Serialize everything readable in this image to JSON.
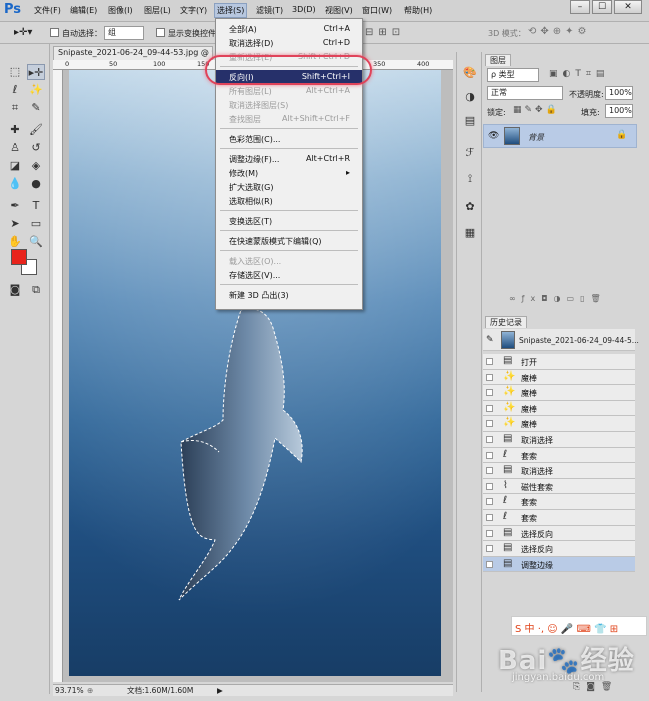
{
  "app": {
    "logo": "Ps"
  },
  "menubar": {
    "items": [
      "文件(F)",
      "编辑(E)",
      "图像(I)",
      "图层(L)",
      "文字(Y)",
      "选择(S)",
      "滤镜(T)",
      "3D(D)",
      "视图(V)",
      "窗口(W)",
      "帮助(H)"
    ],
    "window_controls": [
      "–",
      "☐",
      "✕"
    ]
  },
  "options_bar": {
    "auto_select_label": "自动选择：",
    "auto_select_value": "组",
    "show_transform_label": "显示变换控件",
    "mode_3d_label": "3D 模式："
  },
  "document": {
    "tab_title": "Snipaste_2021-06-24_09-44-53.jpg @ 93.",
    "ruler_marks": [
      "0",
      "50",
      "100",
      "150",
      "200",
      "250",
      "300",
      "350",
      "400"
    ],
    "zoom": "93.71%",
    "doc_info": "文档:1.60M/1.60M"
  },
  "select_menu": {
    "items": [
      {
        "label": "全部(A)",
        "shortcut": "Ctrl+A",
        "disabled": false
      },
      {
        "label": "取消选择(D)",
        "shortcut": "Ctrl+D",
        "disabled": false
      },
      {
        "label": "重新选择(E)",
        "shortcut": "Shift+Ctrl+D",
        "disabled": true
      },
      {
        "label": "反向(I)",
        "shortcut": "Shift+Ctrl+I",
        "disabled": false,
        "highlighted": true
      },
      {
        "label": "所有图层(L)",
        "shortcut": "Alt+Ctrl+A",
        "disabled": true
      },
      {
        "label": "取消选择图层(S)",
        "shortcut": "",
        "disabled": true
      },
      {
        "label": "查找图层",
        "shortcut": "Alt+Shift+Ctrl+F",
        "disabled": true
      },
      {
        "label": "色彩范围(C)...",
        "shortcut": "",
        "disabled": false
      },
      {
        "label": "调整边缘(F)...",
        "shortcut": "Alt+Ctrl+R",
        "disabled": false
      },
      {
        "label": "修改(M)",
        "shortcut": "",
        "disabled": false,
        "submenu": true
      },
      {
        "label": "扩大选取(G)",
        "shortcut": "",
        "disabled": false
      },
      {
        "label": "选取相似(R)",
        "shortcut": "",
        "disabled": false
      },
      {
        "label": "变换选区(T)",
        "shortcut": "",
        "disabled": false
      },
      {
        "label": "在快速蒙版模式下编辑(Q)",
        "shortcut": "",
        "disabled": false
      },
      {
        "label": "载入选区(O)...",
        "shortcut": "",
        "disabled": true
      },
      {
        "label": "存储选区(V)...",
        "shortcut": "",
        "disabled": false
      },
      {
        "label": "新建 3D 凸出(3)",
        "shortcut": "",
        "disabled": false
      }
    ]
  },
  "layers_panel": {
    "tab": "图层",
    "kind_filter": "ρ 类型",
    "blend_mode": "正常",
    "opacity_label": "不透明度:",
    "opacity_value": "100%",
    "lock_label": "锁定:",
    "fill_label": "填充:",
    "fill_value": "100%",
    "layer_name": "背景"
  },
  "history_panel": {
    "tab": "历史记录",
    "snapshot": "Snipaste_2021-06-24_09-44-5...",
    "items": [
      {
        "label": "打开",
        "icon": "document-icon"
      },
      {
        "label": "魔棒",
        "icon": "magic-wand-icon"
      },
      {
        "label": "魔棒",
        "icon": "magic-wand-icon"
      },
      {
        "label": "魔棒",
        "icon": "magic-wand-icon"
      },
      {
        "label": "魔棒",
        "icon": "magic-wand-icon"
      },
      {
        "label": "取消选择",
        "icon": "document-icon"
      },
      {
        "label": "套索",
        "icon": "lasso-icon"
      },
      {
        "label": "取消选择",
        "icon": "document-icon"
      },
      {
        "label": "磁性套索",
        "icon": "magnetic-lasso-icon"
      },
      {
        "label": "套索",
        "icon": "lasso-icon"
      },
      {
        "label": "套索",
        "icon": "lasso-icon"
      },
      {
        "label": "选择反向",
        "icon": "document-icon"
      },
      {
        "label": "选择反向",
        "icon": "document-icon"
      },
      {
        "label": "调整边缘",
        "icon": "document-icon",
        "selected": true
      }
    ]
  },
  "watermark": {
    "brand": "Bai🐾经验",
    "url": "jingyan.baidu.com",
    "ime_bar": "S 中 ·, ☺ 🎤 ⌨ 👕 ⊞"
  },
  "colors": {
    "foreground": "#e8231b",
    "background": "#ffffff",
    "menu_highlight": "#26306a",
    "callout": "#e0435a"
  }
}
